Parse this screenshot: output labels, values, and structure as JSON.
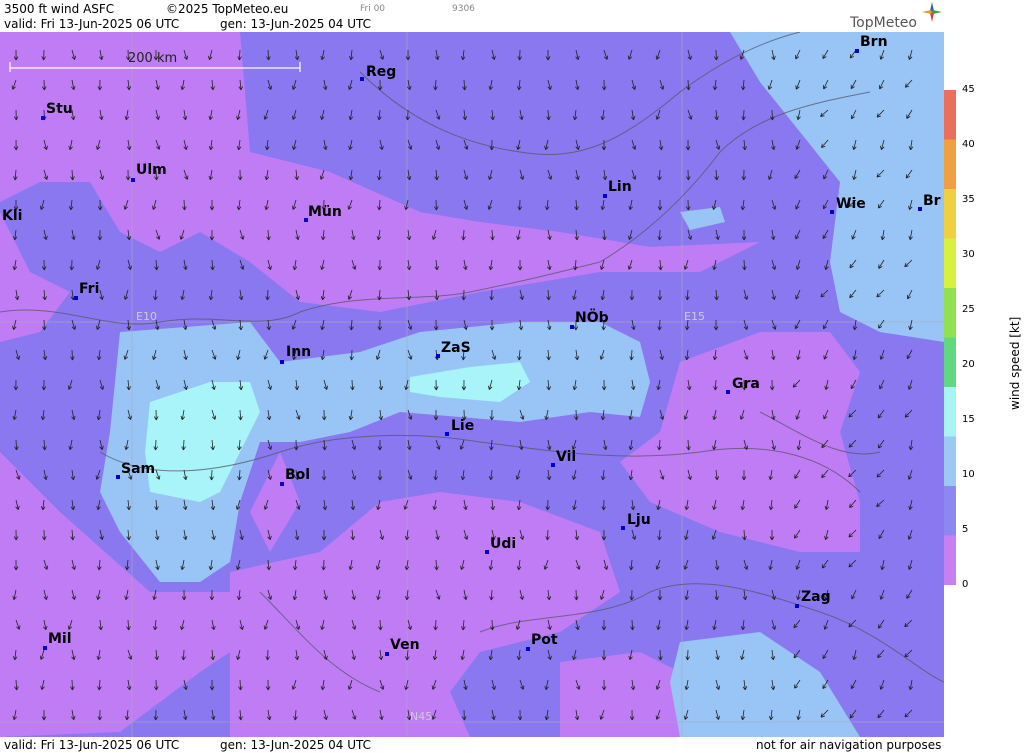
{
  "header": {
    "product": "3500 ft wind ASFC",
    "copyright": "©2025 TopMeteo.eu",
    "fri_code": "Fri 00",
    "run_code": "9306",
    "valid": "valid:  Fri  13-Jun-2025  06 UTC",
    "gen": "gen: 13-Jun-2025 04 UTC",
    "logo": "TopMeteo"
  },
  "footer": {
    "valid": "valid:  Fri  13-Jun-2025  06 UTC",
    "gen": "gen: 13-Jun-2025 04 UTC",
    "note": "not for air navigation purposes"
  },
  "scale": {
    "label": "200 km"
  },
  "grid_labels": {
    "e10": "E10",
    "e15": "E15",
    "n45": "N45"
  },
  "cities": [
    {
      "name": "Reg"
    },
    {
      "name": "Brn"
    },
    {
      "name": "Stu"
    },
    {
      "name": "Ulm"
    },
    {
      "name": "Lin"
    },
    {
      "name": "Kli"
    },
    {
      "name": "Mün"
    },
    {
      "name": "Wie"
    },
    {
      "name": "Br"
    },
    {
      "name": "Fri"
    },
    {
      "name": "NÖb"
    },
    {
      "name": "Inn"
    },
    {
      "name": "ZaS"
    },
    {
      "name": "Gra"
    },
    {
      "name": "Lie"
    },
    {
      "name": "Vil"
    },
    {
      "name": "Sam"
    },
    {
      "name": "Bol"
    },
    {
      "name": "Lju"
    },
    {
      "name": "Udi"
    },
    {
      "name": "Zag"
    },
    {
      "name": "Mil"
    },
    {
      "name": "Pot"
    },
    {
      "name": "Ven"
    }
  ],
  "legend": {
    "title": "wind  speed  [kt]",
    "ticks": [
      "45",
      "40",
      "35",
      "30",
      "25",
      "20",
      "15",
      "10",
      "5",
      "0"
    ],
    "colors": [
      "#e8705c",
      "#f0a040",
      "#f0d040",
      "#d8f040",
      "#90e050",
      "#60d880",
      "#a8f4f4",
      "#9cc8f4",
      "#8c88f0",
      "#c880f0"
    ]
  },
  "map_colors": {
    "violet": "#c07cf4",
    "blue": "#8a78f0",
    "lightblue": "#98c4f6",
    "cyan": "#a8f4f8"
  }
}
